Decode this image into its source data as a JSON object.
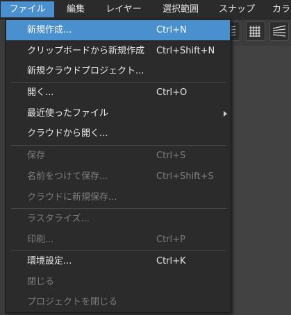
{
  "menubar": {
    "items": [
      {
        "label": "ファイル",
        "active": true
      },
      {
        "label": "編集"
      },
      {
        "label": "レイヤー"
      },
      {
        "label": "選択範囲"
      },
      {
        "label": "スナップ"
      },
      {
        "label": "カラ"
      }
    ]
  },
  "toolbar": {
    "icons": [
      "hatch-icon",
      "grid-icon",
      "perspective-icon"
    ]
  },
  "file_menu": {
    "items": [
      {
        "label": "新規作成...",
        "shortcut": "Ctrl+N",
        "enabled": true,
        "highlighted": true
      },
      {
        "label": "クリップボードから新規作成",
        "shortcut": "Ctrl+Shift+N",
        "enabled": true
      },
      {
        "label": "新規クラウドプロジェクト...",
        "shortcut": "",
        "enabled": true
      },
      {
        "label": "開く...",
        "shortcut": "Ctrl+O",
        "enabled": true
      },
      {
        "label": "最近使ったファイル",
        "shortcut": "",
        "enabled": true,
        "submenu": true
      },
      {
        "label": "クラウドから開く...",
        "shortcut": "",
        "enabled": true
      },
      {
        "label": "保存",
        "shortcut": "Ctrl+S",
        "enabled": false
      },
      {
        "label": "名前をつけて保存...",
        "shortcut": "Ctrl+Shift+S",
        "enabled": false
      },
      {
        "label": "クラウドに新規保存...",
        "shortcut": "",
        "enabled": false
      },
      {
        "label": "ラスタライズ...",
        "shortcut": "",
        "enabled": false
      },
      {
        "label": "印刷...",
        "shortcut": "Ctrl+P",
        "enabled": false
      },
      {
        "label": "環境設定...",
        "shortcut": "Ctrl+K",
        "enabled": true
      },
      {
        "label": "閉じる",
        "shortcut": "",
        "enabled": false
      },
      {
        "label": "プロジェクトを閉じる",
        "shortcut": "",
        "enabled": false
      }
    ]
  },
  "colors": {
    "highlight": "#4a90cf",
    "menu_bg": "#2b2b2b",
    "disabled_text": "#7d7d7d"
  }
}
